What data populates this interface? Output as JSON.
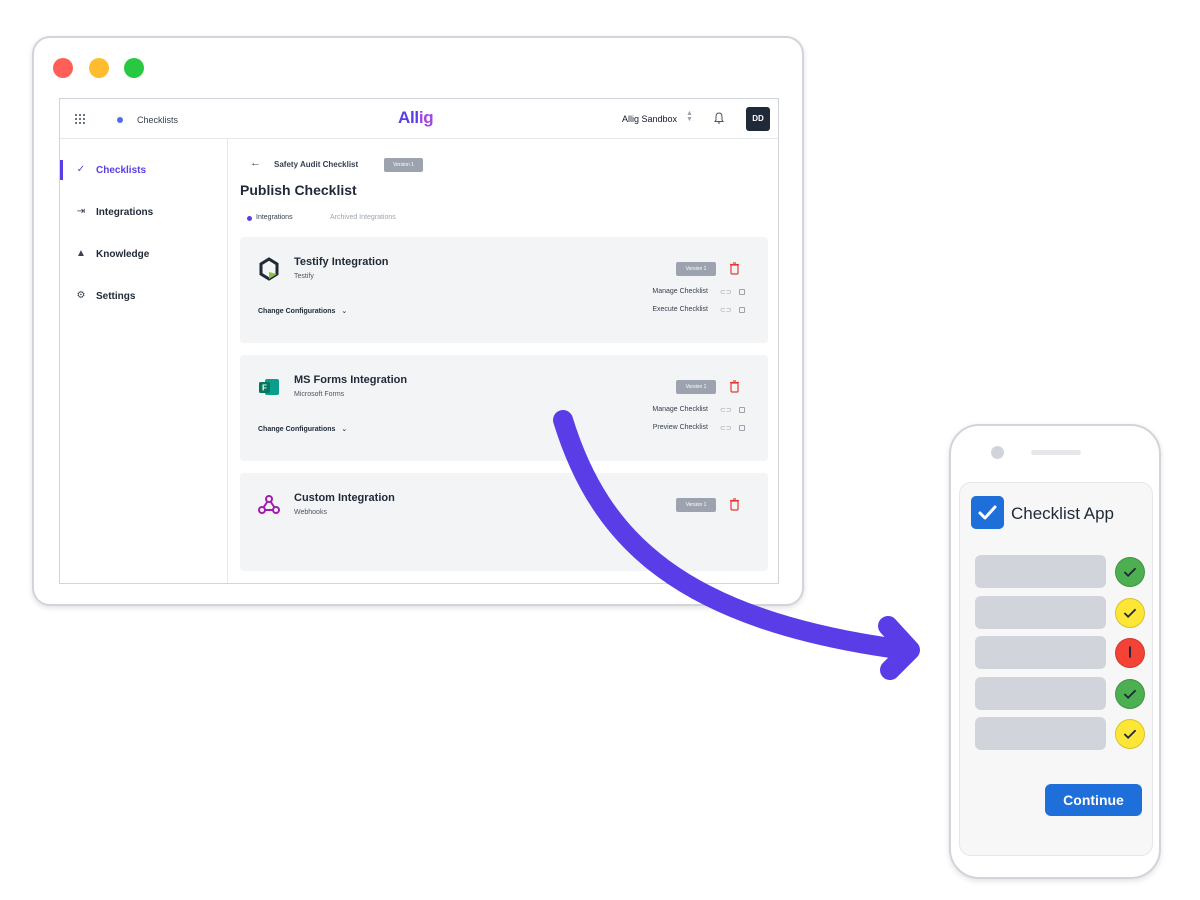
{
  "app": {
    "breadcrumb_label": "Checklists",
    "logo_text": "Allig",
    "org_name": "Allig Sandbox",
    "avatar_initials": "DD"
  },
  "sidebar": {
    "items": [
      {
        "label": "Checklists",
        "icon": "check-icon",
        "active": true
      },
      {
        "label": "Integrations",
        "icon": "integrations-icon",
        "active": false
      },
      {
        "label": "Knowledge",
        "icon": "graduation-cap-icon",
        "active": false
      },
      {
        "label": "Settings",
        "icon": "gear-icon",
        "active": false
      }
    ]
  },
  "header": {
    "checklist_name": "Safety Audit Checklist",
    "version_badge": "Version 1",
    "page_title": "Publish Checklist",
    "tabs": [
      "Integrations",
      "Archived Integrations"
    ],
    "active_tab": "Integrations"
  },
  "integrations": [
    {
      "title": "Testify Integration",
      "subtitle": "Testify",
      "version": "Version 1",
      "change_label": "Change Configurations",
      "actions": [
        "Manage Checklist",
        "Execute Checklist"
      ],
      "icon": "testify-logo-icon"
    },
    {
      "title": "MS Forms Integration",
      "subtitle": "Microsoft Forms",
      "version": "Version 1",
      "change_label": "Change Configurations",
      "actions": [
        "Manage Checklist",
        "Preview Checklist"
      ],
      "icon": "ms-forms-logo-icon"
    },
    {
      "title": "Custom Integration",
      "subtitle": "Webhooks",
      "version": "Version 1",
      "change_label": "",
      "actions": [],
      "icon": "webhooks-logo-icon"
    }
  ],
  "phone": {
    "app_title": "Checklist App",
    "items": [
      {
        "status": "ok"
      },
      {
        "status": "warn"
      },
      {
        "status": "err"
      },
      {
        "status": "ok"
      },
      {
        "status": "warn"
      }
    ],
    "continue_label": "Continue"
  },
  "colors": {
    "brand": "#5b3de8",
    "arrow": "#5b3de8",
    "phone_accent": "#1e6fd9",
    "ok": "#4caf50",
    "warn": "#fde636",
    "err": "#f44336"
  }
}
